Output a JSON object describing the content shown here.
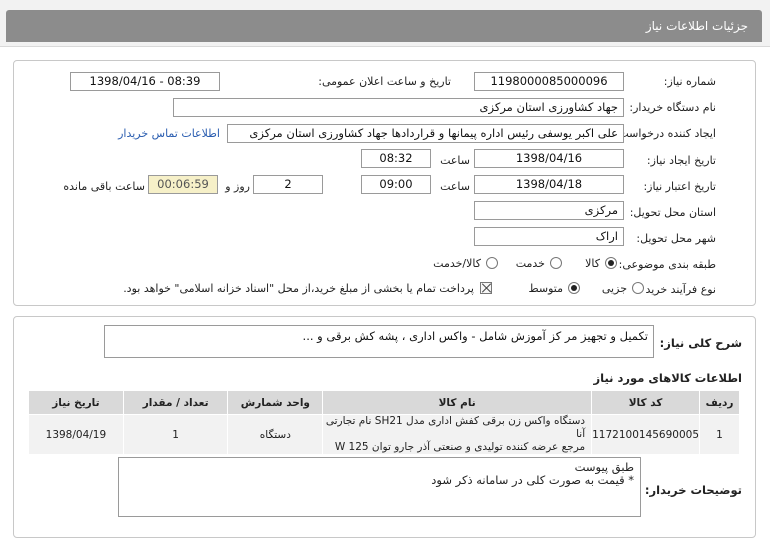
{
  "header": {
    "title": "جزئیات اطلاعات نیاز"
  },
  "form": {
    "need_number": {
      "label": "شماره نیاز:",
      "value": "1198000085000096"
    },
    "announce": {
      "label": "تاریخ و ساعت اعلان عمومی:",
      "value": "1398/04/16 - 08:39"
    },
    "buyer_org": {
      "label": "نام دستگاه خریدار:",
      "value": "جهاد کشاورزی استان مرکزی"
    },
    "requester": {
      "label": "ایجاد کننده درخواست:",
      "value": "علی اکبر یوسفی رئیس اداره پیمانها و قراردادها جهاد کشاورزی استان مرکزی",
      "contact_link": "اطلاعات تماس خریدار"
    },
    "created": {
      "label": "تاریخ ایجاد نیاز:",
      "date": "1398/04/16",
      "time_label": "ساعت",
      "time": "08:32"
    },
    "validity": {
      "label": "تاریخ اعتبار نیاز:",
      "date": "1398/04/18",
      "time_label": "ساعت",
      "time": "09:00",
      "days": "2",
      "days_label": "روز و",
      "remaining": "00:06:59",
      "remaining_label": "ساعت باقی مانده"
    },
    "province": {
      "label": "استان محل تحویل:",
      "value": "مرکزی"
    },
    "city": {
      "label": "شهر محل تحویل:",
      "value": "اراک"
    },
    "category": {
      "label": "طبقه بندی موضوعی:",
      "options": [
        "کالا",
        "خدمت",
        "کالا/خدمت"
      ],
      "selected": "کالا"
    },
    "process": {
      "label": "نوع فرآیند خرید :",
      "options": [
        "جزیی",
        "متوسط"
      ],
      "selected": "متوسط",
      "treasury_note": "پرداخت تمام یا بخشی از مبلغ خرید،از محل \"اسناد خزانه اسلامی\" خواهد بود."
    }
  },
  "summary": {
    "label": "شرح کلی نیاز:",
    "value": "تکمیل و تجهیز مر کز آموزش شامل - واکس اداری ، پشه کش برقی و ..."
  },
  "items": {
    "title": "اطلاعات کالاهای مورد نیاز",
    "headers": {
      "row": "ردیف",
      "code": "کد کالا",
      "name": "نام کالا",
      "unit": "واحد شمارش",
      "qty": "تعداد / مقدار",
      "date": "تاریخ نیاز"
    },
    "rows": [
      {
        "row": "1",
        "code": "1172100145690005",
        "name_line1": "دستگاه واکس زن برقی کفش اداری مدل SH21 نام تجارتی آنا",
        "name_line2": "مرجع عرضه کننده تولیدی و صنعتی آذر جارو توان W 125",
        "unit": "دستگاه",
        "qty": "1",
        "date": "1398/04/19"
      }
    ]
  },
  "buyer_notes": {
    "label": "توضیحات خریدار:",
    "value": "طبق پیوست\n* قیمت به صورت کلی در سامانه ذکر شود"
  }
}
